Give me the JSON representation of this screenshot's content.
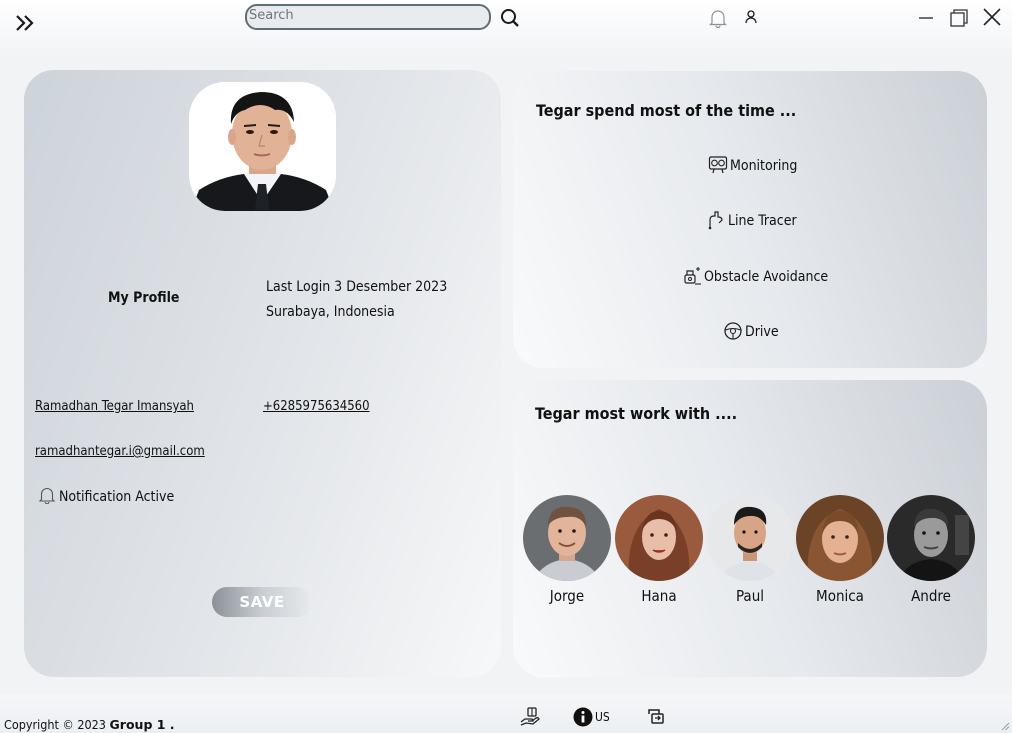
{
  "topbar": {
    "search_placeholder": "Search",
    "menu_icon": "double-chevron-right-icon",
    "search_icon": "magnifier-icon",
    "bell_icon": "bell-icon",
    "user_icon": "user-icon",
    "window_controls": [
      "minimize-icon",
      "restore-icon",
      "close-icon"
    ]
  },
  "profile": {
    "section_label": "My Profile",
    "last_login": "Last Login 3 Desember 2023",
    "location": "Surabaya, Indonesia",
    "name": "Ramadhan Tegar Imansyah",
    "phone": "+6285975634560",
    "email": "ramadhantegar.i@gmail.com",
    "notification": "Notification Active",
    "save_label": "SAVE"
  },
  "activities": {
    "title": "Tegar spend most of the time ...",
    "items": [
      {
        "label": "Monitoring",
        "icon": "monitoring-icon"
      },
      {
        "label": "Line Tracer",
        "icon": "line-tracer-icon"
      },
      {
        "label": "Obstacle Avoidance",
        "icon": "obstacle-avoidance-icon"
      },
      {
        "label": "Drive",
        "icon": "steering-wheel-icon"
      }
    ]
  },
  "team": {
    "title": "Tegar most work with ....",
    "members": [
      {
        "name": "Jorge"
      },
      {
        "name": "Hana"
      },
      {
        "name": "Paul"
      },
      {
        "name": "Monica"
      },
      {
        "name": "Andre"
      }
    ]
  },
  "footer": {
    "copyright_prefix": "Copyright © 2023 ",
    "copyright_group": "Group 1 .",
    "us_label": "US",
    "icons": [
      "support-icon",
      "info-icon",
      "exchange-icon"
    ]
  },
  "colors": {
    "accent_border": "#5e6e78",
    "card_gray": "#cdd3da",
    "text": "#111111"
  }
}
